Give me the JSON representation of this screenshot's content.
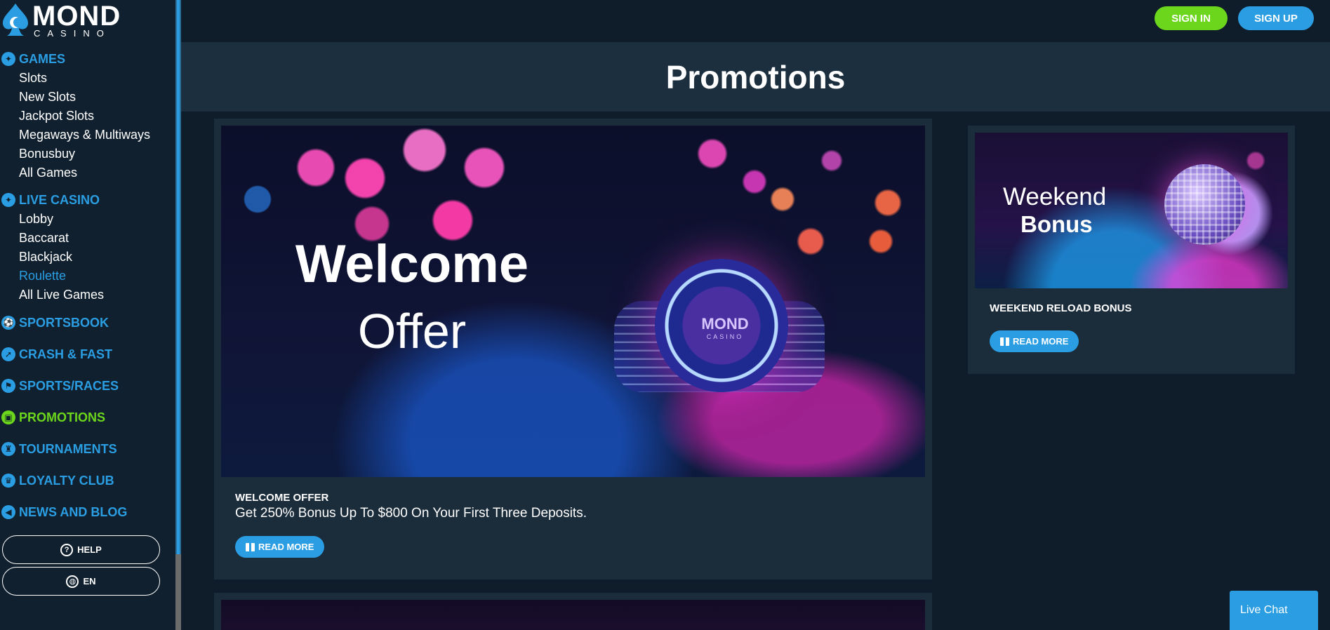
{
  "brand": {
    "word": "MOND",
    "sub": "CASINO"
  },
  "sidebar": {
    "sections": [
      {
        "label": "GAMES",
        "icon": "games-icon",
        "items": [
          "Slots",
          "New Slots",
          "Jackpot Slots",
          "Megaways & Multiways",
          "Bonusbuy",
          "All Games"
        ]
      },
      {
        "label": "LIVE CASINO",
        "icon": "live-casino-icon",
        "items": [
          "Lobby",
          "Baccarat",
          "Blackjack",
          "Roulette",
          "All Live Games"
        ],
        "active_item": "Roulette"
      },
      {
        "label": "SPORTSBOOK",
        "icon": "sportsbook-icon"
      },
      {
        "label": "CRASH & FAST",
        "icon": "rocket-icon"
      },
      {
        "label": "SPORTS/RACES",
        "icon": "races-icon"
      },
      {
        "label": "PROMOTIONS",
        "icon": "gift-icon",
        "active": true
      },
      {
        "label": "TOURNAMENTS",
        "icon": "trophy-icon"
      },
      {
        "label": "LOYALTY CLUB",
        "icon": "crown-icon"
      },
      {
        "label": "NEWS AND BLOG",
        "icon": "megaphone-icon"
      }
    ],
    "help_label": "HELP",
    "lang_label": "EN"
  },
  "header": {
    "sign_in": "SIGN IN",
    "sign_up": "SIGN UP"
  },
  "page": {
    "title": "Promotions"
  },
  "promos": [
    {
      "banner_title": "Welcome",
      "banner_subtitle": "Offer",
      "chip_word": "MOND",
      "chip_sub": "CASINO",
      "kicker": "WELCOME OFFER",
      "description": "Get 250% Bonus Up To $800 On Your First Three Deposits.",
      "cta": "READ MORE"
    },
    {
      "banner_title": "Weekend",
      "banner_subtitle": "Bonus",
      "kicker": "WEEKEND RELOAD BONUS",
      "cta": "READ MORE"
    }
  ],
  "chat": {
    "label": "Live Chat"
  },
  "colors": {
    "accent_blue": "#2b9ee3",
    "accent_green": "#6cd61c",
    "bg": "#0f1d2b",
    "card": "#1b2c3b"
  }
}
